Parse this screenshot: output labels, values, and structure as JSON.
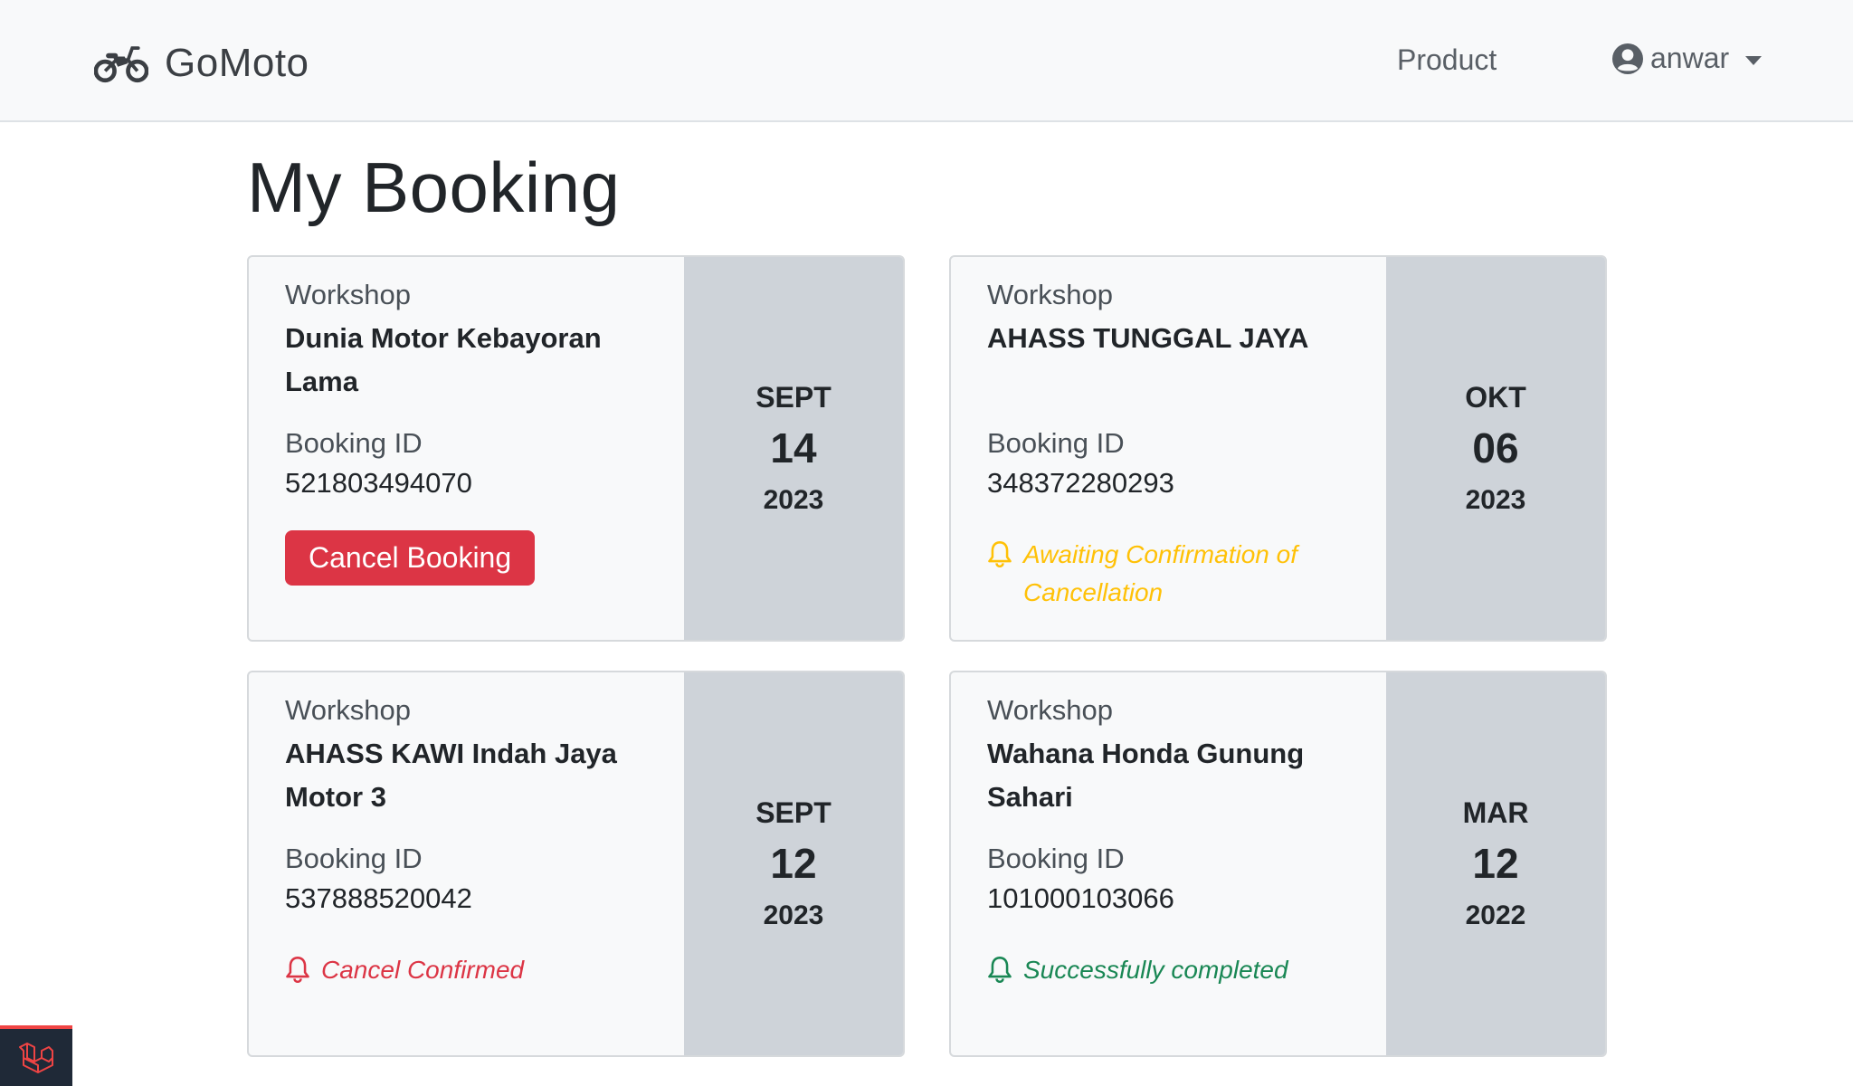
{
  "navbar": {
    "brand": "GoMoto",
    "brand_icon": "motorcycle-icon",
    "product_link": "Product",
    "user_name": "anwar",
    "user_icon": "user-circle-icon"
  },
  "page": {
    "title": "My Booking"
  },
  "labels": {
    "workshop": "Workshop",
    "booking_id": "Booking ID"
  },
  "colors": {
    "danger": "#dc3545",
    "warning": "#ffc107",
    "success": "#198754"
  },
  "bookings": [
    {
      "workshop": "Dunia Motor Kebayoran Lama",
      "booking_id": "521803494070",
      "month": "SEPT",
      "day": "14",
      "year": "2023",
      "action": "Cancel Booking"
    },
    {
      "workshop": "AHASS TUNGGAL JAYA",
      "booking_id": "348372280293",
      "month": "OKT",
      "day": "06",
      "year": "2023",
      "status": "Awaiting Confirmation of Cancellation",
      "status_type": "warning"
    },
    {
      "workshop": "AHASS KAWI Indah Jaya Motor 3",
      "booking_id": "537888520042",
      "month": "SEPT",
      "day": "12",
      "year": "2023",
      "status": "Cancel Confirmed",
      "status_type": "danger"
    },
    {
      "workshop": "Wahana Honda Gunung Sahari",
      "booking_id": "101000103066",
      "month": "MAR",
      "day": "12",
      "year": "2022",
      "status": "Successfully completed",
      "status_type": "success"
    }
  ],
  "debug_badge": {
    "icon": "laravel-icon"
  }
}
